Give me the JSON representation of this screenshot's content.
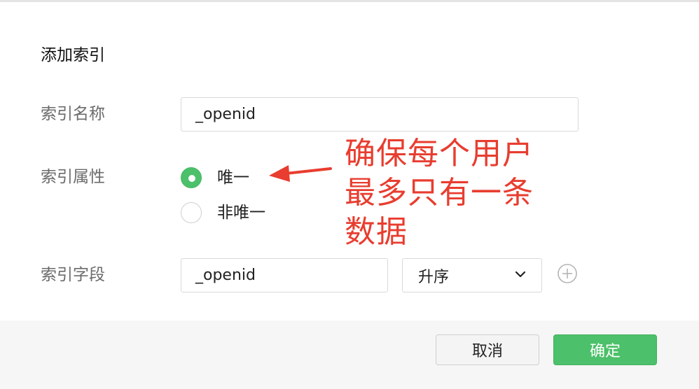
{
  "dialog": {
    "title": "添加索引",
    "fields": {
      "index_name_label": "索引名称",
      "index_name_value": "_openid",
      "index_attr_label": "索引属性",
      "index_field_label": "索引字段",
      "index_field_value": "_openid",
      "sort_order_value": "升序"
    },
    "radio_options": {
      "unique": "唯一",
      "non_unique": "非唯一",
      "selected": "unique"
    }
  },
  "annotation": {
    "line1": "确保每个用户",
    "line2": "最多只有一条",
    "line3": "数据",
    "color": "#e83d2f"
  },
  "footer": {
    "cancel_label": "取消",
    "confirm_label": "确定"
  },
  "colors": {
    "accent": "#4cc06a",
    "annotation": "#e83d2f"
  }
}
